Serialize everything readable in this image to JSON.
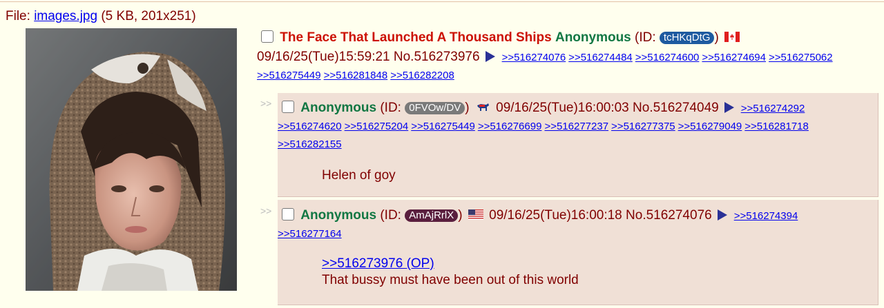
{
  "file": {
    "prefix": "File: ",
    "name": "images.jpg",
    "meta": " (5 KB, 201x251)"
  },
  "op": {
    "subject": "The Face That Launched A Thousand Ships",
    "name": "Anonymous",
    "id_label": " (ID: ",
    "id": "tcHKqDtG",
    "id_close": ")",
    "id_color": "#1e5aa0",
    "flag_icon": "canada-flag",
    "datetime": "09/16/25(Tue)15:59:21",
    "postno": "No.516273976",
    "backlinks": [
      ">>516274076",
      ">>516274484",
      ">>516274600",
      ">>516274694",
      ">>516275062",
      ">>516275449",
      ">>516281848",
      ">>516282208"
    ]
  },
  "replies": [
    {
      "arrows": ">>",
      "name": "Anonymous",
      "id_label": " (ID: ",
      "id": "0FVOw/DV",
      "id_close": ")",
      "id_color": "#7a7a7a",
      "flag_icon": "democrat-donkey-flag",
      "datetime": "09/16/25(Tue)16:00:03",
      "postno": "No.516274049",
      "backlinks": [
        ">>516274292",
        ">>516274620",
        ">>516275204",
        ">>516275449",
        ">>516276699",
        ">>516277237",
        ">>516277375",
        ">>516279049",
        ">>516281718",
        ">>516282155"
      ],
      "quote": "",
      "text": "Helen of goy"
    },
    {
      "arrows": ">>",
      "name": "Anonymous",
      "id_label": " (ID: ",
      "id": "AmAjRrlX",
      "id_close": ")",
      "id_color": "#5a1e3e",
      "flag_icon": "us-flag",
      "datetime": "09/16/25(Tue)16:00:18",
      "postno": "No.516274076",
      "backlinks": [
        ">>516274394",
        ">>516277164"
      ],
      "quote": ">>516273976 (OP)",
      "text": "That bussy must have been out of this world"
    }
  ]
}
